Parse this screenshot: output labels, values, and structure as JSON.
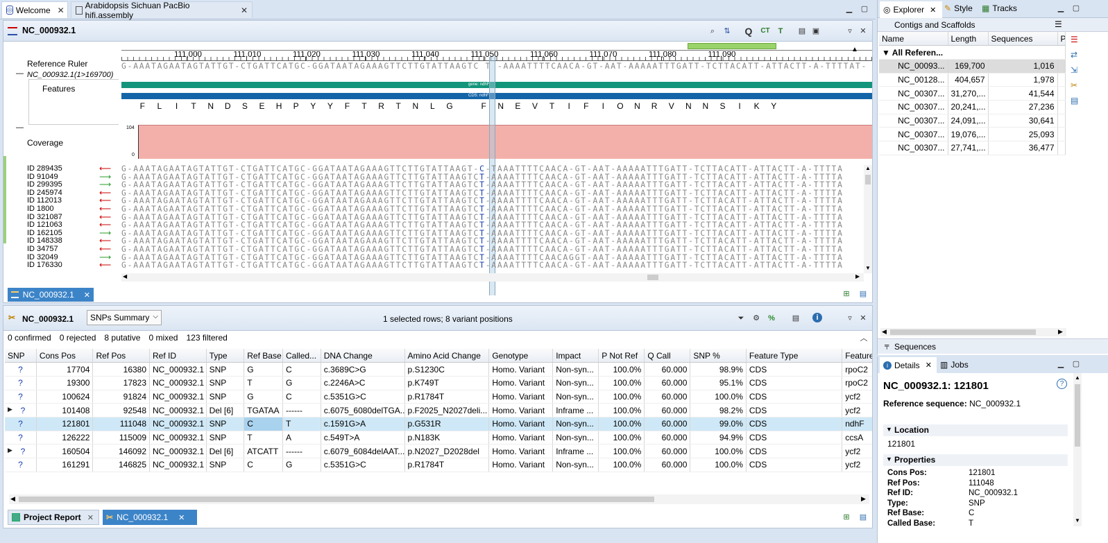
{
  "tabs": {
    "welcome": "Welcome",
    "assembly": "Arabidopsis Sichuan PacBio hifi.assembly"
  },
  "editor": {
    "title": "NC_000932.1",
    "bottom_tab": "NC_000932.1"
  },
  "track": {
    "ruler_label": "Reference Ruler",
    "ref_name": "NC_000932.1(1>169700)",
    "features_label": "Features",
    "coverage_label": "Coverage",
    "cov_max": "104",
    "cov_min": "0",
    "ticks": [
      "111,000",
      "111,010",
      "111,020",
      "111,030",
      "111,040",
      "111,050",
      "111,060",
      "111,070",
      "111,080",
      "111,090"
    ],
    "ref_seq": "G-AAATAGAATAGTATTGT-CTGATTCATGC-GGATAATAGAAAGTTCTTGTATTAAGTC T -AAAATTTTCAACA-GT-AAT-AAAAATTTGATT-TCTTACATT-ATTACTT-A-TTTTAT-",
    "gene_label": "gene: ndhF",
    "cds_label": "CDS: ndhF",
    "amino_acids": [
      "F",
      "L",
      "I",
      "T",
      "N",
      "D",
      "S",
      "E",
      "H",
      "P",
      "Y",
      "Y",
      "F",
      "T",
      "R",
      "T",
      "N",
      "L",
      "G",
      "",
      "F",
      "N",
      "E",
      "V",
      "T",
      "I",
      "F",
      "I",
      "O",
      "N",
      "R",
      "V",
      "N",
      "N",
      "S",
      "I",
      "K",
      "Y"
    ]
  },
  "reads": [
    {
      "id": "ID 289435",
      "dir": "left",
      "seq_a": "G-AAATAGAATAGTATTGT-CTGATTCATGC-GGATAATAGAAAGTTCTTGTATTAAGT-",
      "mid": "C",
      "seq_b": "-TAAATTTTCAACA-GT-AAT-AAAAATTTGATT-TCTTACATT-ATTACTT-A-TTTTA"
    },
    {
      "id": "ID 91049",
      "dir": "right",
      "seq_a": "G-AAATAGAATAGTATTGT-CTGATTCATGC-GGATAATAGAAAGTTCTTGTATTAAGTC",
      "mid": "T",
      "seq_b": "-AAAATTTTCAACA-GT-AAT-AAAAATTTGATT-TCTTACATT-ATTACTT-A-TTTTA"
    },
    {
      "id": "ID 299395",
      "dir": "right",
      "seq_a": "G-AAATAGAATAGTATTGT-CTGATTCATGC-GGATAATAGAAAGTTCTTGTATTAAGTC",
      "mid": "T",
      "seq_b": "-AAAATTTTCAACA-GT-AAT-AAAAATTTGATT-TCTTACATT-ATTACTT-A-TTTTA"
    },
    {
      "id": "ID 245974",
      "dir": "left",
      "seq_a": "G-AAATAGAATAGTATTGT-CTGATTCATGC-GGATAATAGAAAGTTCTTGTATTAAGTC",
      "mid": "T",
      "seq_b": "-AAAATTTTCAACA-GT-AAT-AAAAATTTGATT-TCTTACATT-ATTACTT-A-TTTTA"
    },
    {
      "id": "ID 112013",
      "dir": "left",
      "seq_a": "G-AAATAGAATAGTATTGT-CTGATTCATGC-GGATAATAGAAAGTTCTTGTATTAAGTC",
      "mid": "T",
      "seq_b": "-AAAATTTTCAACA-GT-AAT-AAAAATTTGATT-TCTTACATT-ATTACTT-A-TTTTA"
    },
    {
      "id": "ID 1800",
      "dir": "left",
      "seq_a": "G-AAATAGAATAGTATTGT-CTGATTCATGC-GGATAATAGAAAGTTCTTGTATTAAGTC",
      "mid": "T",
      "seq_b": "-AAAATTTTCAACA-GT-AAT-AAAAATTTGATT-TCTTACATT-ATTACTT-A-TTTTA"
    },
    {
      "id": "ID 321087",
      "dir": "left",
      "seq_a": "G-AAATAGAATAGTATTGT-CTGATTCATGC-GGATAATAGAAAGTTCTTGTATTAAGTC",
      "mid": "T",
      "seq_b": "-AAAATTTTCAACA-GT-AAT-AAAAATTTGATT-TCTTACATT-ATTACTT-A-TTTTA"
    },
    {
      "id": "ID 121063",
      "dir": "left",
      "seq_a": "G-AAATAGAATAGTATTGT-CTGATTCATGC-GGATAATAGAAAGTTCTTGTATTAAGTC",
      "mid": "T",
      "seq_b": "-AAAATTTTCAACA-GT-AAT-AAAAATTTGATT-TCTTACATT-ATTACTT-A-TTTTA"
    },
    {
      "id": "ID 162105",
      "dir": "right",
      "seq_a": "G-AAATAGAATAGTATTGT-CTGATTCATGC-GGATAATAGAAAGTTCTTGTATTAAGTC",
      "mid": "T",
      "seq_b": "-AAAATTTTCAACA-GT-AAT-AAAAATTTGATT-TCTTACATT-ATTACTT-A-TTTTA"
    },
    {
      "id": "ID 148338",
      "dir": "left",
      "seq_a": "G-AAATAGAATAGTATTGT-CTGATTCATGC-GGATAATAGAAAGTTCTTGTATTAAGTC",
      "mid": "T",
      "seq_b": "-AAAATTTTCAACA-GT-AAT-AAAAATTTGATT-TCTTACATT-ATTACTT-A-TTTTA"
    },
    {
      "id": "ID 34757",
      "dir": "left",
      "seq_a": "G-AAATAGAATAGTATTGT-CTGATTCATGC-GGATAATAGAAAGTTCTTGTATTAAGTC",
      "mid": "T",
      "seq_b": "-AAAATTTTCAACA-GT-AAT-AAAAATTTGATT-TCTTACATT-ATTACTT-A-TTTTA"
    },
    {
      "id": "ID 32049",
      "dir": "right",
      "seq_a": "G-AAATAGAATAGTATTGT-CTGATTCATGC-GGATAATAGAAAGTTCTTGTATTAAGTC",
      "mid": "T",
      "seq_b": "-AAAATTTTCAACAGGT-AAT-AAAAATTTGATT-TCTTACATT-ATTACTT-A-TTTTA"
    },
    {
      "id": "ID 176330",
      "dir": "left",
      "seq_a": "G-AAATAGAATAGTATTGT-CTGATTCATGC-GGATAATAGAAAGTTCTTGTATTAAGTC",
      "mid": "T",
      "seq_b": "-AAAATTTTCAACA-GT-AAT-AAAAATTTGATT-TCTTACATT-ATTACTT-A-TTTTA"
    }
  ],
  "snp": {
    "title": "NC_000932.1",
    "view_select": "SNPs Summary",
    "status": "1 selected rows; 8 variant positions",
    "counts": {
      "confirmed": "0 confirmed",
      "rejected": "0 rejected",
      "putative": "8 putative",
      "mixed": "0 mixed",
      "filtered": "123 filtered"
    },
    "columns": [
      "SNP",
      "Cons Pos",
      "Ref Pos",
      "Ref ID",
      "Type",
      "Ref Base",
      "Called...",
      "DNA Change",
      "Amino Acid Change",
      "Genotype",
      "Impact",
      "P Not Ref",
      "Q Call",
      "SNP %",
      "Feature Type",
      "Feature Name"
    ],
    "rows": [
      [
        "?",
        "17704",
        "16380",
        "NC_000932.1",
        "SNP",
        "G",
        "C",
        "c.3689C>G",
        "p.S1230C",
        "Homo. Variant",
        "Non-syn...",
        "100.0%",
        "60.000",
        "98.9%",
        "CDS",
        "rpoC2"
      ],
      [
        "?",
        "19300",
        "17823",
        "NC_000932.1",
        "SNP",
        "T",
        "G",
        "c.2246A>C",
        "p.K749T",
        "Homo. Variant",
        "Non-syn...",
        "100.0%",
        "60.000",
        "95.1%",
        "CDS",
        "rpoC2"
      ],
      [
        "?",
        "100624",
        "91824",
        "NC_000932.1",
        "SNP",
        "G",
        "C",
        "c.5351G>C",
        "p.R1784T",
        "Homo. Variant",
        "Non-syn...",
        "100.0%",
        "60.000",
        "100.0%",
        "CDS",
        "ycf2"
      ],
      [
        "?",
        "101408",
        "92548",
        "NC_000932.1",
        "Del  [6]",
        "TGATAA",
        "------",
        "c.6075_6080delTGA...",
        "p.F2025_N2027deli...",
        "Homo. Variant",
        "Inframe ...",
        "100.0%",
        "60.000",
        "98.2%",
        "CDS",
        "ycf2"
      ],
      [
        "?",
        "121801",
        "111048",
        "NC_000932.1",
        "SNP",
        "C",
        "T",
        "c.1591G>A",
        "p.G531R",
        "Homo. Variant",
        "Non-syn...",
        "100.0%",
        "60.000",
        "99.0%",
        "CDS",
        "ndhF"
      ],
      [
        "?",
        "126222",
        "115009",
        "NC_000932.1",
        "SNP",
        "T",
        "A",
        "c.549T>A",
        "p.N183K",
        "Homo. Variant",
        "Non-syn...",
        "100.0%",
        "60.000",
        "94.9%",
        "CDS",
        "ccsA"
      ],
      [
        "?",
        "160504",
        "146092",
        "NC_000932.1",
        "Del  [6]",
        "ATCATT",
        "------",
        "c.6079_6084delAAT...",
        "p.N2027_D2028del",
        "Homo. Variant",
        "Inframe ...",
        "100.0%",
        "60.000",
        "100.0%",
        "CDS",
        "ycf2"
      ],
      [
        "?",
        "161291",
        "146825",
        "NC_000932.1",
        "SNP",
        "C",
        "G",
        "c.5351G>C",
        "p.R1784T",
        "Homo. Variant",
        "Non-syn...",
        "100.0%",
        "60.000",
        "100.0%",
        "CDS",
        "ycf2"
      ]
    ],
    "expandable": [
      3,
      6
    ],
    "selected": 4
  },
  "bottom_tabs": {
    "project_report": "Project Report",
    "snp_tab": "NC_000932.1"
  },
  "explorer": {
    "tabs": {
      "explorer": "Explorer",
      "style": "Style",
      "tracks": "Tracks"
    },
    "section": "Contigs and Scaffolds",
    "columns": [
      "Name",
      "Length",
      "Sequences",
      "P"
    ],
    "group": "All Referen...",
    "rows": [
      [
        "NC_00093...",
        "169,700",
        "1,016"
      ],
      [
        "NC_00128...",
        "404,657",
        "1,978"
      ],
      [
        "NC_00307...",
        "31,270,...",
        "41,544"
      ],
      [
        "NC_00307...",
        "20,241,...",
        "27,236"
      ],
      [
        "NC_00307...",
        "24,091,...",
        "30,641"
      ],
      [
        "NC_00307...",
        "19,076,...",
        "25,093"
      ],
      [
        "NC_00307...",
        "27,741,...",
        "36,477"
      ]
    ],
    "sequences_label": "Sequences"
  },
  "details": {
    "tabs": {
      "details": "Details",
      "jobs": "Jobs"
    },
    "title": "NC_000932.1: 121801",
    "ref_seq_label": "Reference sequence:",
    "ref_seq_value": "NC_000932.1",
    "location_label": "Location",
    "location_value": "121801",
    "properties_label": "Properties",
    "props": [
      [
        "Cons Pos:",
        "121801"
      ],
      [
        "Ref Pos:",
        "111048"
      ],
      [
        "Ref ID:",
        "NC_000932.1"
      ],
      [
        "Type:",
        "SNP"
      ],
      [
        "Ref Base:",
        "C"
      ],
      [
        "Called Base:",
        "T"
      ]
    ]
  }
}
